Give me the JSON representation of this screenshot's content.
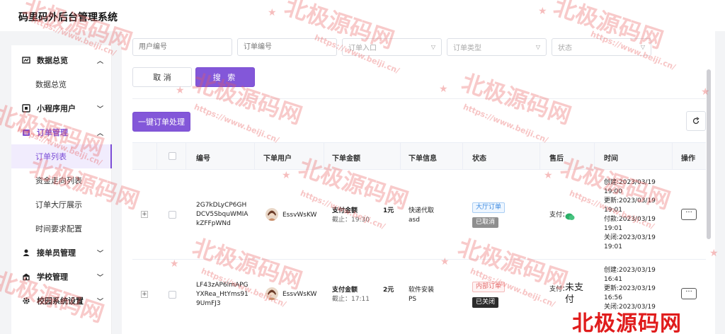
{
  "app": {
    "title": "码里码外后台管理系统"
  },
  "sidebar": {
    "items": [
      {
        "kind": "group",
        "label": "数据总览",
        "icon": "chart-icon",
        "chevron": "up"
      },
      {
        "kind": "sub",
        "label": "数据总览"
      },
      {
        "kind": "group",
        "label": "小程序用户",
        "icon": "mini-program-icon",
        "chevron": "down"
      },
      {
        "kind": "group",
        "label": "订单管理",
        "icon": "order-icon",
        "chevron": "up",
        "active": true
      },
      {
        "kind": "sub",
        "label": "订单列表",
        "active": true
      },
      {
        "kind": "sub",
        "label": "资金走向列表"
      },
      {
        "kind": "sub",
        "label": "订单大厅展示"
      },
      {
        "kind": "sub",
        "label": "时间要求配置"
      },
      {
        "kind": "group",
        "label": "接单员管理",
        "icon": "worker-icon",
        "chevron": "down"
      },
      {
        "kind": "group",
        "label": "学校管理",
        "icon": "school-icon",
        "chevron": "down"
      },
      {
        "kind": "group",
        "label": "校园系统设置",
        "icon": "gear-icon",
        "chevron": "down"
      }
    ]
  },
  "filters": {
    "user_no_placeholder": "用户编号",
    "order_no_placeholder": "订单编号",
    "order_entry_placeholder": "订单入口",
    "order_type_placeholder": "订单类型",
    "status_placeholder": "状态"
  },
  "actions": {
    "cancel_label": "取 消",
    "search_label": "搜 索",
    "batch_label": "一键订单处理"
  },
  "table": {
    "headers": {
      "id": "编号",
      "user": "下单用户",
      "amount": "下单金额",
      "info": "下单信息",
      "status": "状态",
      "after_sale": "售后",
      "time": "时间",
      "ops": "操作"
    },
    "rows": [
      {
        "id_lines": [
          "2G7kDLyCP6GH",
          "DCV5SbquWMIA",
          "kZFFpWNd"
        ],
        "user": "EssvWsKW",
        "amount_label": "支付金额",
        "amount_value": "1元",
        "deadline": "截止：19:30",
        "info_type": "快递代取",
        "info_detail": "asd",
        "status_tag": "大厅订单",
        "status_sub": "已取消",
        "after_sale_label": "支付：",
        "pay_icon": "wechat-pay-icon",
        "time_lines": [
          "创建:2023/03/19",
          "19:00",
          "更新:2023/03/19",
          "19:01",
          "付款:2023/03/19",
          "19:01",
          "关闭:2023/03/19",
          "19:01"
        ]
      },
      {
        "id_lines": [
          "LF43zAP6lmAPG",
          "YXRea_HtYms91",
          "9UmFJ3"
        ],
        "user": "EssvWsKW",
        "amount_label": "支付金额",
        "amount_value": "2元",
        "deadline": "截止：17:11",
        "info_type": "软件安装",
        "info_detail": "PS",
        "status_tag": "内部订单",
        "status_sub": "已关闭",
        "after_sale_label": "支付：",
        "after_sale_value": "未支付",
        "time_lines": [
          "创建:2023/03/19",
          "16:41",
          "更新:2023/03/19",
          "16:56",
          "关闭:2023/03/19"
        ]
      }
    ]
  },
  "watermark": {
    "brand": "北极源码网",
    "url": "https://www.beiji.cn/"
  },
  "colors": {
    "accent": "#8357d9",
    "watermark": "#e85a5a",
    "brand_red": "#e01c1c"
  }
}
